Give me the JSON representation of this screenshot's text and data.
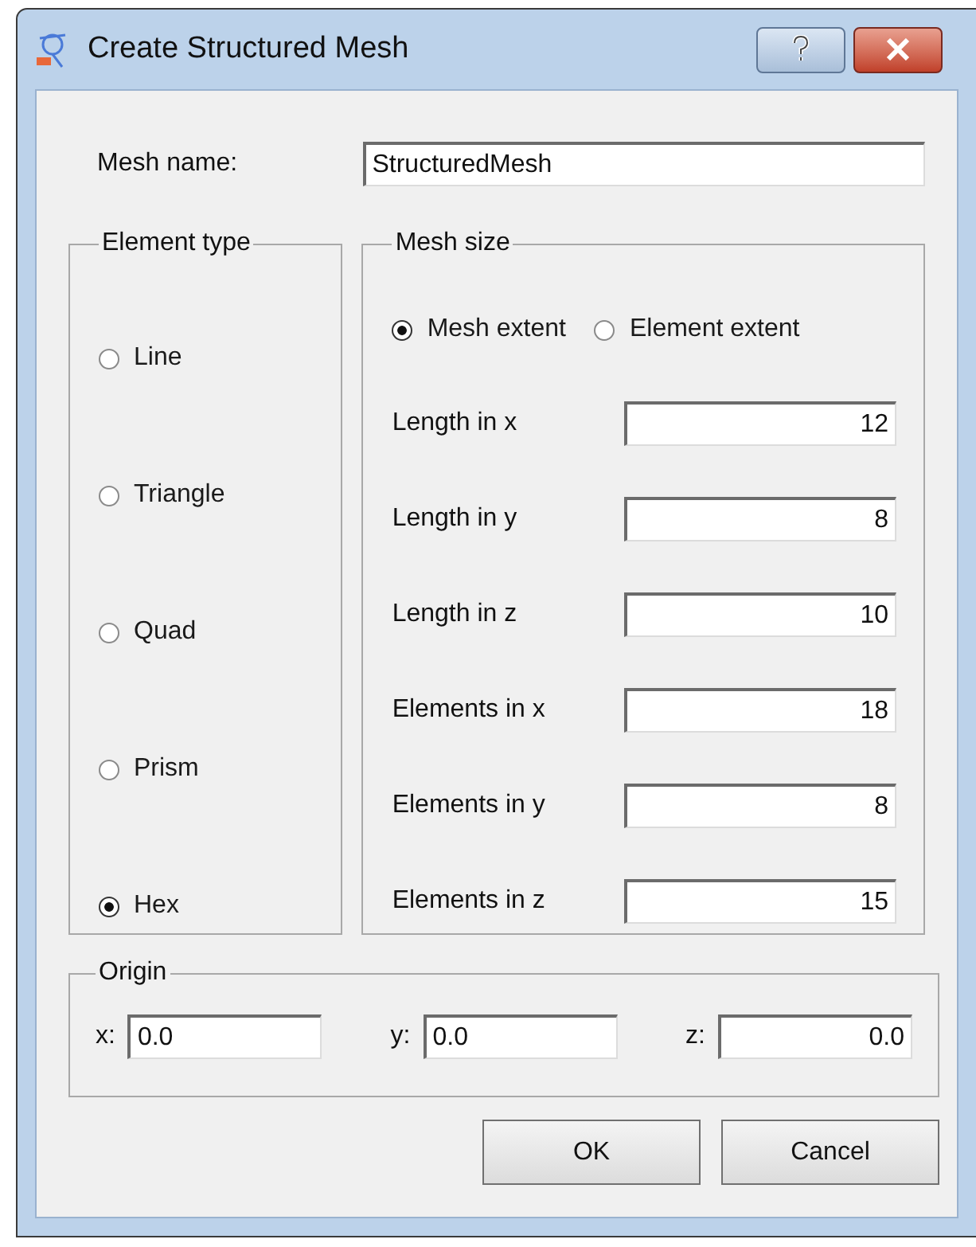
{
  "window": {
    "title": "Create Structured Mesh"
  },
  "mesh_name": {
    "label": "Mesh name:",
    "value": "StructuredMesh"
  },
  "element_type": {
    "title": "Element type",
    "options": [
      {
        "label": "Line",
        "selected": false
      },
      {
        "label": "Triangle",
        "selected": false
      },
      {
        "label": "Quad",
        "selected": false
      },
      {
        "label": "Prism",
        "selected": false
      },
      {
        "label": "Hex",
        "selected": true
      }
    ]
  },
  "mesh_size": {
    "title": "Mesh size",
    "modes": [
      {
        "label": "Mesh extent",
        "selected": true
      },
      {
        "label": "Element extent",
        "selected": false
      }
    ],
    "fields": [
      {
        "label": "Length in x",
        "value": "12"
      },
      {
        "label": "Length in y",
        "value": "8"
      },
      {
        "label": "Length in z",
        "value": "10"
      },
      {
        "label": "Elements in x",
        "value": "18"
      },
      {
        "label": "Elements in y",
        "value": "8"
      },
      {
        "label": "Elements in z",
        "value": "15"
      }
    ]
  },
  "origin": {
    "title": "Origin",
    "fields": [
      {
        "label": "x:",
        "value": "0.0",
        "kind": "left-aligned"
      },
      {
        "label": "y:",
        "value": "0.0",
        "kind": "left-aligned"
      },
      {
        "label": "z:",
        "value": "0.0",
        "kind": "right-aligned"
      }
    ]
  },
  "buttons": [
    "OK",
    "Cancel"
  ]
}
